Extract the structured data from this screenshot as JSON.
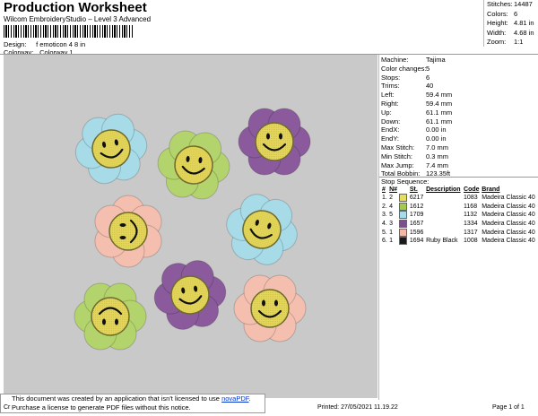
{
  "header": {
    "title": "Production Worksheet",
    "subtitle": "Wilcom EmbroideryStudio – Level 3 Advanced",
    "design_label": "Design:",
    "design_value": "f emoticon 4 8 in",
    "colorway_label": "Colorway:",
    "colorway_value": "Colorway 1"
  },
  "stats": [
    {
      "k": "Stitches:",
      "v": "14487"
    },
    {
      "k": "Colors:",
      "v": "6"
    },
    {
      "k": "Height:",
      "v": "4.81 in"
    },
    {
      "k": "Width:",
      "v": "4.68 in"
    },
    {
      "k": "Zoom:",
      "v": "1:1"
    }
  ],
  "info": [
    {
      "k": "Machine:",
      "v": "Tajima"
    },
    {
      "k": "Color changes:",
      "v": "5"
    },
    {
      "k": "Stops:",
      "v": "6"
    },
    {
      "k": "Trims:",
      "v": "40"
    },
    {
      "k": "Left:",
      "v": "59.4 mm"
    },
    {
      "k": "Right:",
      "v": "59.4 mm"
    },
    {
      "k": "Up:",
      "v": "61.1 mm"
    },
    {
      "k": "Down:",
      "v": "61.1 mm"
    },
    {
      "k": "EndX:",
      "v": "0.00 in"
    },
    {
      "k": "EndY:",
      "v": "0.00 in"
    },
    {
      "k": "Max Stitch:",
      "v": "7.0 mm"
    },
    {
      "k": "Min Stitch:",
      "v": "0.3 mm"
    },
    {
      "k": "Max Jump:",
      "v": "7.4 mm"
    },
    {
      "k": "Total Bobbin:",
      "v": "123.35ft"
    }
  ],
  "stop_sequence": {
    "title": "Stop Sequence:",
    "headers": [
      "#",
      "N#",
      "",
      "St.",
      "Description",
      "Code",
      "Brand"
    ],
    "rows": [
      {
        "num": "1.",
        "n": "2",
        "color": "#e6dd5c",
        "st": "6217",
        "desc": "",
        "code": "1083",
        "brand": "Madeira Classic 40"
      },
      {
        "num": "2.",
        "n": "4",
        "color": "#9fcb4f",
        "st": "1612",
        "desc": "",
        "code": "1168",
        "brand": "Madeira Classic 40"
      },
      {
        "num": "3.",
        "n": "5",
        "color": "#a7dbe8",
        "st": "1709",
        "desc": "",
        "code": "1132",
        "brand": "Madeira Classic 40"
      },
      {
        "num": "4.",
        "n": "3",
        "color": "#7b4f8e",
        "st": "1657",
        "desc": "",
        "code": "1334",
        "brand": "Madeira Classic 40"
      },
      {
        "num": "5.",
        "n": "1",
        "color": "#f4b9a6",
        "st": "1596",
        "desc": "",
        "code": "1317",
        "brand": "Madeira Classic 40"
      },
      {
        "num": "6.",
        "n": "1",
        "color": "#1a1a1a",
        "st": "1694",
        "desc": "Ruby Black",
        "code": "1008",
        "brand": "Madeira Classic 40"
      }
    ]
  },
  "notice": {
    "line1": "This document was created by an application that isn't licensed to use ",
    "link": "novaPDF",
    "line1_end": ".",
    "line2": "Purchase a license to generate PDF files without this notice."
  },
  "footer": {
    "left": "Cr",
    "printed": "Printed: 27/05/2021 11.19.22",
    "page": "Page 1 of 1"
  },
  "flowers": [
    {
      "name": "flower-blue-top-left",
      "petal": "#a7dbe8"
    },
    {
      "name": "flower-green-top",
      "petal": "#b3d46c"
    },
    {
      "name": "flower-purple-top-right",
      "petal": "#8a5a9c"
    },
    {
      "name": "flower-peach-middle-left",
      "petal": "#f4bfae"
    },
    {
      "name": "flower-blue-middle-right",
      "petal": "#a7dbe8"
    },
    {
      "name": "flower-purple-bottom-center",
      "petal": "#8a5a9c"
    },
    {
      "name": "flower-green-bottom-left",
      "petal": "#b3d46c"
    },
    {
      "name": "flower-peach-bottom-right",
      "petal": "#f4bfae"
    }
  ]
}
